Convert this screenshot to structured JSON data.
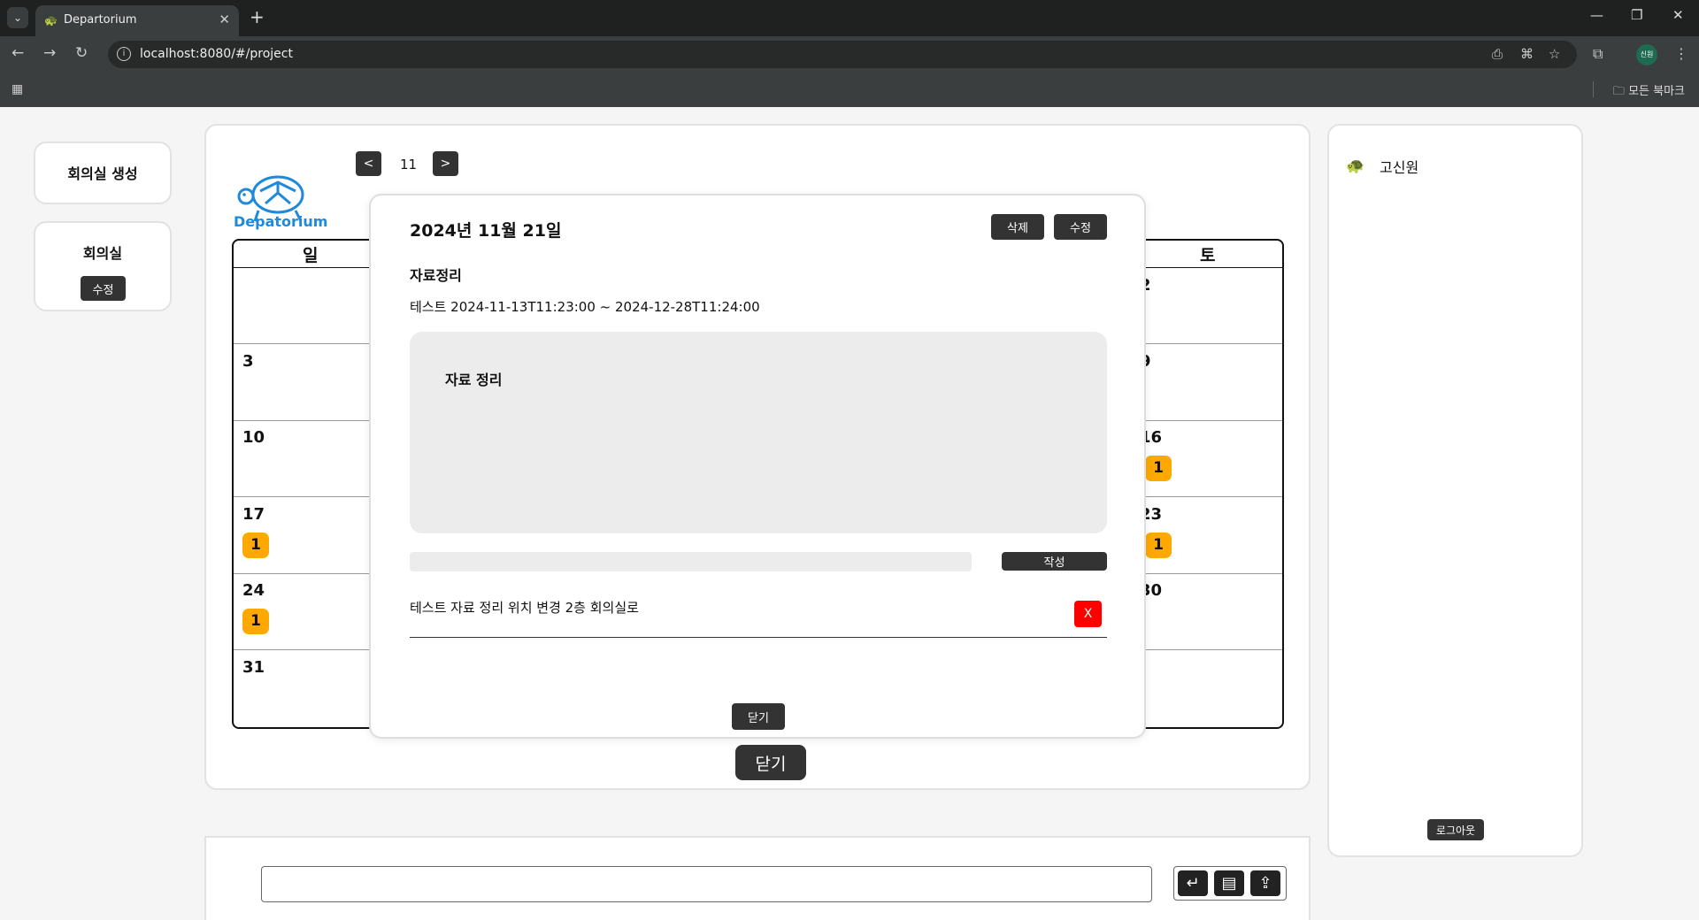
{
  "browser": {
    "tab_title": "Departorium",
    "url": "localhost:8080/#/project",
    "profile_label": "신원",
    "all_bookmarks": "모든 북마크"
  },
  "sidebar": {
    "create_room": "회의실 생성",
    "rooms_title": "회의실",
    "edit_label": "수정"
  },
  "header": {
    "logo_text": "Depatorium",
    "prev": "<",
    "next": ">",
    "month": "11"
  },
  "calendar": {
    "day_headers": [
      "일",
      "토"
    ],
    "days": [
      "3",
      "10",
      "17",
      "24",
      "31",
      "2",
      "9",
      "16",
      "23",
      "30"
    ],
    "badges": [
      "1",
      "1",
      "1",
      "1"
    ]
  },
  "main_close": "닫기",
  "modal": {
    "date_title": "2024년 11월 21일",
    "delete_label": "삭제",
    "edit_label": "수정",
    "subject": "자료정리",
    "range": "테스트 2024-11-13T11:23:00 ~ 2024-12-28T11:24:00",
    "content": "자료 정리",
    "write_label": "작성",
    "comment": "테스트  자료 정리 위치 변경 2층 회의실로",
    "delete_comment": "X",
    "close_label": "닫기"
  },
  "right_panel": {
    "user_name": "고신원",
    "logout": "로그아웃"
  },
  "colors": {
    "badge": "#ffa800",
    "logo_blue": "#1f8ad9",
    "delete_red": "#ff0000",
    "dark_button": "#333333"
  }
}
